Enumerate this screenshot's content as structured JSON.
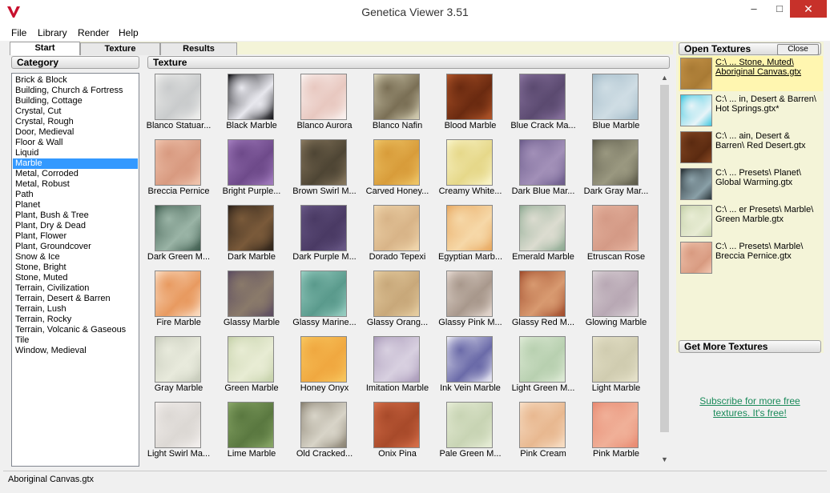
{
  "window": {
    "title": "Genetica Viewer 3.51",
    "minimize": "–",
    "maximize": "□",
    "close": "✕"
  },
  "menu": [
    "File",
    "Library",
    "Render",
    "Help"
  ],
  "tabs": [
    {
      "label": "Start",
      "active": true
    },
    {
      "label": "Texture",
      "active": false
    },
    {
      "label": "Results",
      "active": false
    }
  ],
  "category": {
    "header": "Category",
    "selected": "Marble",
    "items": [
      "Brick & Block",
      "Building, Church & Fortress",
      "Building, Cottage",
      "Crystal, Cut",
      "Crystal, Rough",
      "Door, Medieval",
      "Floor & Wall",
      "Liquid",
      "Marble",
      "Metal, Corroded",
      "Metal, Robust",
      "Path",
      "Planet",
      "Plant, Bush & Tree",
      "Plant, Dry & Dead",
      "Plant, Flower",
      "Plant, Groundcover",
      "Snow & Ice",
      "Stone, Bright",
      "Stone, Muted",
      "Terrain, Civilization",
      "Terrain, Desert & Barren",
      "Terrain, Lush",
      "Terrain, Rocky",
      "Terrain, Volcanic & Gaseous",
      "Tile",
      "Window, Medieval"
    ]
  },
  "texture": {
    "header": "Texture",
    "items": [
      {
        "label": "Blanco Statuar...",
        "c1": "#f2f2f0",
        "c2": "#c9cbcc"
      },
      {
        "label": "Black Marble",
        "c1": "#0e0e12",
        "c2": "#e8e8ee"
      },
      {
        "label": "Blanco Aurora",
        "c1": "#fbf4f2",
        "c2": "#e8c8c0"
      },
      {
        "label": "Blanco Nafin",
        "c1": "#d9d3b8",
        "c2": "#7a6f55"
      },
      {
        "label": "Blood Marble",
        "c1": "#b2562a",
        "c2": "#6a2a10"
      },
      {
        "label": "Blue Crack Ma...",
        "c1": "#8a74a0",
        "c2": "#5b4a70"
      },
      {
        "label": "Blue Marble",
        "c1": "#9fb8c6",
        "c2": "#cfdde4"
      },
      {
        "label": "Breccia Pernice",
        "c1": "#f2c8b2",
        "c2": "#d89a80"
      },
      {
        "label": "Bright Purple...",
        "c1": "#a47ec0",
        "c2": "#6e4a8a"
      },
      {
        "label": "Brown Swirl M...",
        "c1": "#8a7a60",
        "c2": "#4e4534"
      },
      {
        "label": "Carved Honey...",
        "c1": "#f0c86a",
        "c2": "#d89c3a"
      },
      {
        "label": "Creamy White...",
        "c1": "#fbf6cc",
        "c2": "#e6d88a"
      },
      {
        "label": "Dark Blue Mar...",
        "c1": "#6a5a8a",
        "c2": "#a290b8"
      },
      {
        "label": "Dark Gray Mar...",
        "c1": "#5a5848",
        "c2": "#9a9880"
      },
      {
        "label": "Dark Green M...",
        "c1": "#3c5a4c",
        "c2": "#9ab4a6"
      },
      {
        "label": "Dark Marble",
        "c1": "#2a2018",
        "c2": "#7a5a3a"
      },
      {
        "label": "Dark Purple M...",
        "c1": "#6a5a88",
        "c2": "#4a3a64"
      },
      {
        "label": "Dorado Tepexi",
        "c1": "#f2d9b0",
        "c2": "#d8b488"
      },
      {
        "label": "Egyptian Marb...",
        "c1": "#e8a860",
        "c2": "#f6d8a8"
      },
      {
        "label": "Emerald Marble",
        "c1": "#8aa890",
        "c2": "#dcdcd0"
      },
      {
        "label": "Etruscan Rose",
        "c1": "#e8b8a4",
        "c2": "#d49a86"
      },
      {
        "label": "Fire Marble",
        "c1": "#fbe0c8",
        "c2": "#e89a60"
      },
      {
        "label": "Glassy Marble",
        "c1": "#5a4a60",
        "c2": "#8a7a6a"
      },
      {
        "label": "Glassy Marine...",
        "c1": "#9ad0c4",
        "c2": "#5a9a8c"
      },
      {
        "label": "Glassy Orang...",
        "c1": "#e8d0a4",
        "c2": "#c8a87a"
      },
      {
        "label": "Glassy Pink M...",
        "c1": "#e8dcd4",
        "c2": "#a8988c"
      },
      {
        "label": "Glassy Red M...",
        "c1": "#a04a2a",
        "c2": "#d89a70"
      },
      {
        "label": "Glowing Marble",
        "c1": "#dcd4d8",
        "c2": "#b8a8b4"
      },
      {
        "label": "Gray Marble",
        "c1": "#c4c8b8",
        "c2": "#e8eadc"
      },
      {
        "label": "Green Marble",
        "c1": "#c4d0a8",
        "c2": "#e8ecd4"
      },
      {
        "label": "Honey Onyx",
        "c1": "#f8c860",
        "c2": "#f0a840"
      },
      {
        "label": "Imitation Marble",
        "c1": "#a898b8",
        "c2": "#d8d0e0"
      },
      {
        "label": "Ink Vein Marble",
        "c1": "#f0f0f8",
        "c2": "#6a6aa8"
      },
      {
        "label": "Light Green M...",
        "c1": "#e0ecd8",
        "c2": "#b8d0b0"
      },
      {
        "label": "Light Marble",
        "c1": "#e8e4cc",
        "c2": "#d0ccb0"
      },
      {
        "label": "Light Swirl Ma...",
        "c1": "#f4f0ee",
        "c2": "#dcd8d4"
      },
      {
        "label": "Lime Marble",
        "c1": "#8aa868",
        "c2": "#5a7840"
      },
      {
        "label": "Old Cracked...",
        "c1": "#888070",
        "c2": "#d8d4c8"
      },
      {
        "label": "Onix Pina",
        "c1": "#d8704a",
        "c2": "#a84a2a"
      },
      {
        "label": "Pale Green M...",
        "c1": "#e8eed8",
        "c2": "#c8d4b4"
      },
      {
        "label": "Pink Cream",
        "c1": "#f8e0c8",
        "c2": "#e8b890"
      },
      {
        "label": "Pink Marble",
        "c1": "#e88870",
        "c2": "#f0b098"
      }
    ]
  },
  "open_textures": {
    "header": "Open Textures",
    "close_label": "Close",
    "items": [
      {
        "text": "C:\\ ...  Stone, Muted\\ Aboriginal Canvas.gtx",
        "c1": "#c8964a",
        "c2": "#a87a34",
        "selected": true
      },
      {
        "text": "C:\\ ... in, Desert & Barren\\ Hot Springs.gtx*",
        "c1": "#40c8e0",
        "c2": "#e8f4f8",
        "selected": false
      },
      {
        "text": "C:\\ ... ain, Desert & Barren\\ Red Desert.gtx",
        "c1": "#8a4a24",
        "c2": "#5a2a10",
        "selected": false
      },
      {
        "text": "C:\\ ...  Presets\\ Planet\\ Global Warming.gtx",
        "c1": "#2a3438",
        "c2": "#8aa0a8",
        "selected": false
      },
      {
        "text": "C:\\ ... er Presets\\ Marble\\ Green Marble.gtx",
        "c1": "#c4d0a8",
        "c2": "#e8ecd4",
        "selected": false
      },
      {
        "text": "C:\\ ...  Presets\\ Marble\\ Breccia Pernice.gtx",
        "c1": "#f2c8b2",
        "c2": "#d89a80",
        "selected": false
      }
    ]
  },
  "get_more": {
    "header": "Get More Textures",
    "link": "Subscribe for more free textures.  It's free!"
  },
  "status": "Aboriginal Canvas.gtx"
}
